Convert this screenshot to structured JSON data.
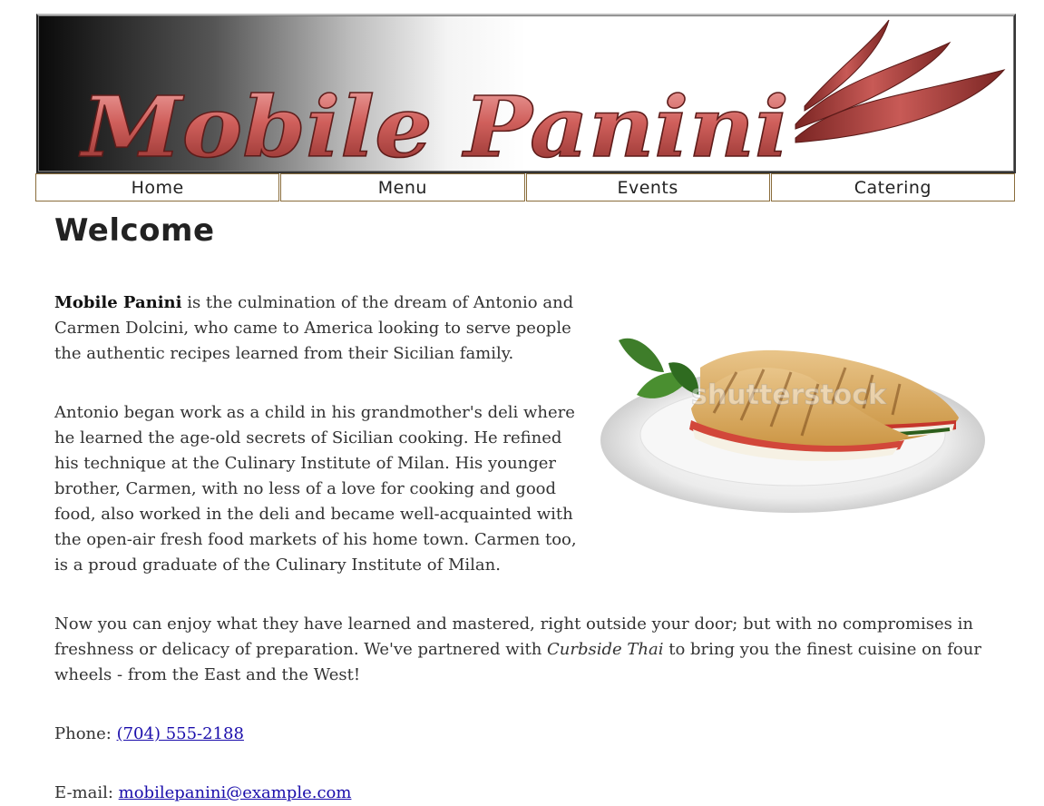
{
  "banner": {
    "logo_text": "Mobile Panini"
  },
  "nav": {
    "items": [
      "Home",
      "Menu",
      "Events",
      "Catering"
    ]
  },
  "main": {
    "title": "Welcome",
    "p1_brand": "Mobile Panini",
    "p1_rest": " is the culmination of the dream of Antonio and Carmen Dolcini, who came to America looking to serve people the authentic recipes learned from their Sicilian family.",
    "p2": "Antonio began work as a child in his grandmother's deli where he learned the age-old secrets of Sicilian cooking. He refined his technique at the Culinary Institute of Milan. His younger brother, Carmen, with no less of a love for cooking and good food, also worked in the deli and became well-acquainted with the open-air fresh food markets of his home town. Carmen too, is a proud graduate of the Culinary Institute of Milan.",
    "p3_before": "Now you can enjoy what they have learned and mastered, right outside your door; but with no compromises in freshness or delicacy of preparation. We've partnered with ",
    "p3_partner": "Curbside Thai",
    "p3_after": " to bring you the finest cuisine on four wheels - from the East and the West!",
    "phone_label": "Phone: ",
    "phone_value": "(704) 555-2188",
    "phone_href": "tel:7045552188",
    "email_label": "E-mail: ",
    "email_value": "mobilepanini@example.com",
    "email_href": "mailto:mobilepanini@example.com"
  },
  "photo": {
    "watermark": "shutterstock"
  },
  "colors": {
    "logo_red": "#c0504d",
    "nav_border": "#8a6d3b",
    "link": "#1a0dab"
  }
}
